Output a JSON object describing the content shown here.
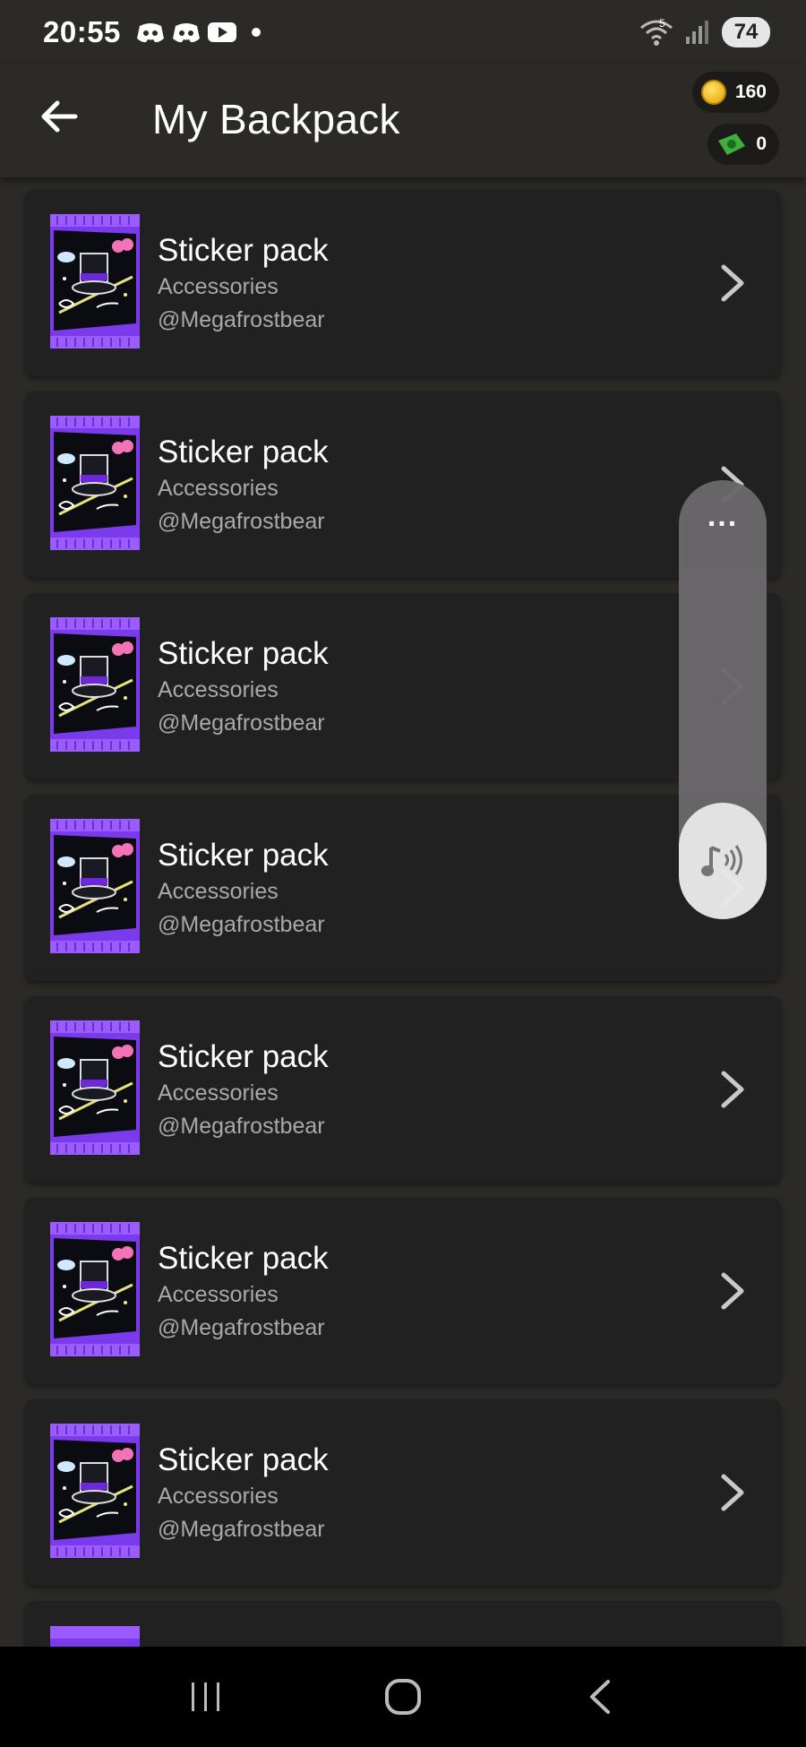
{
  "status_bar": {
    "time": "20:55",
    "battery": "74",
    "network_sup": "5",
    "notification_icons": [
      "discord-icon",
      "discord-icon",
      "youtube-icon"
    ]
  },
  "header": {
    "title": "My Backpack",
    "coins": "160",
    "cash": "0"
  },
  "items": [
    {
      "title": "Sticker pack",
      "category": "Accessories",
      "owner": "@Megafrostbear"
    },
    {
      "title": "Sticker pack",
      "category": "Accessories",
      "owner": "@Megafrostbear"
    },
    {
      "title": "Sticker pack",
      "category": "Accessories",
      "owner": "@Megafrostbear"
    },
    {
      "title": "Sticker pack",
      "category": "Accessories",
      "owner": "@Megafrostbear"
    },
    {
      "title": "Sticker pack",
      "category": "Accessories",
      "owner": "@Megafrostbear"
    },
    {
      "title": "Sticker pack",
      "category": "Accessories",
      "owner": "@Megafrostbear"
    },
    {
      "title": "Sticker pack",
      "category": "Accessories",
      "owner": "@Megafrostbear"
    }
  ],
  "volume_panel": {
    "more_label": "..."
  },
  "colors": {
    "background": "#2c2a27",
    "card": "#212121",
    "pack_purple": "#7c3aed",
    "secondary_text": "#a9a9a9"
  }
}
